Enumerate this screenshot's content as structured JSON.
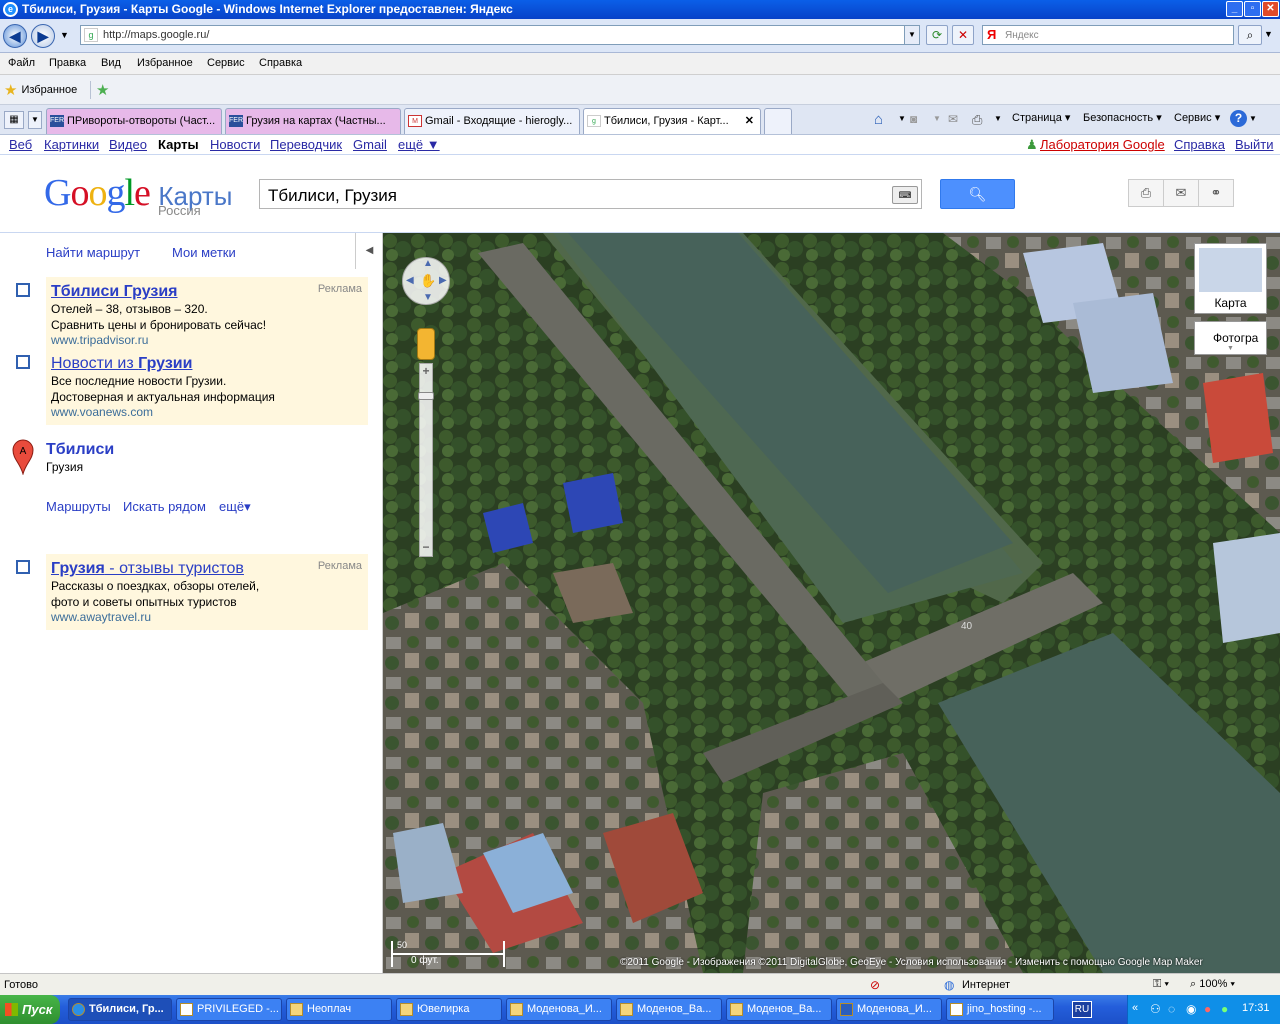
{
  "window": {
    "title": "Тбилиси, Грузия - Карты Google - Windows Internet Explorer предоставлен: Яндекс"
  },
  "addressbar": {
    "url": "http://maps.google.ru/",
    "search_placeholder": "Яндекс"
  },
  "menu": [
    "Файл",
    "Правка",
    "Вид",
    "Избранное",
    "Сервис",
    "Справка"
  ],
  "favorites": {
    "label": "Избранное"
  },
  "tabs": [
    {
      "label": "ПРивороты-отвороты (Част...",
      "active": false,
      "color": "#e7b9e9"
    },
    {
      "label": "Грузия на картах (Частны...",
      "active": false,
      "color": "#e7b9e9"
    },
    {
      "label": "Gmail - Входящие - hierogly...",
      "active": false,
      "color": "#eef2fb"
    },
    {
      "label": "Тбилиси, Грузия - Карт...",
      "active": true,
      "color": "#ffffff"
    }
  ],
  "ie_toolbar": {
    "page": "Страница",
    "security": "Безопасность",
    "tools": "Сервис"
  },
  "gbar": {
    "links": [
      "Веб",
      "Картинки",
      "Видео",
      "Карты",
      "Новости",
      "Переводчик",
      "Gmail",
      "ещё ▼"
    ],
    "active": "Карты",
    "right": {
      "lab": "Лаборатория Google",
      "help": "Справка",
      "logout": "Выйти"
    }
  },
  "header": {
    "logo_brand": "Google",
    "logo_product": "Карты",
    "logo_region": "Россия",
    "query": "Тбилиси, Грузия"
  },
  "left_panel": {
    "links": {
      "directions": "Найти маршрут",
      "my_places": "Мои метки"
    },
    "ads_top": [
      {
        "title_a": "Тбилиси Грузия",
        "title_b": "",
        "line1": "Отелей – 38, отзывов – 320.",
        "line2": "Сравнить цены и бронировать сейчас!",
        "url": "www.tripadvisor.ru",
        "label": "Реклама"
      },
      {
        "title_a": "Новости из ",
        "title_b": "Грузии",
        "line1": "Все последние новости Грузии.",
        "line2": "Достоверная и актуальная информация",
        "url": "www.voanews.com",
        "label": ""
      }
    ],
    "result": {
      "marker": "A",
      "name": "Тбилиси",
      "country": "Грузия",
      "actions": [
        "Маршруты",
        "Искать рядом",
        "ещё▾"
      ]
    },
    "ad_bottom": {
      "title_a": "Грузия",
      "title_b": " - отзывы туристов",
      "line1": "Рассказы о поездках, обзоры отелей,",
      "line2": "фото и советы опытных туристов",
      "url": "www.awaytravel.ru",
      "label": "Реклама"
    }
  },
  "map": {
    "type_buttons": {
      "map": "Карта",
      "photos": "Фотогра"
    },
    "scale": {
      "top": "50",
      "bottom": "0 фут."
    },
    "copyright": "©2011 Google - Изображения ©2011 DigitalGlobe, GeoEye - Условия использования - Изменить с помощью Google Map Maker",
    "label_road": "40"
  },
  "statusbar": {
    "left": "Готово",
    "zone": "Интернет",
    "zoom": "100%"
  },
  "taskbar": {
    "start": "Пуск",
    "items": [
      "Тбилиси, Гр...",
      "PRIVILEGED -...",
      "Неоплач",
      "Ювелирка",
      "Моденова_И...",
      "Моденов_Ва...",
      "Моденов_Ва...",
      "Моденова_И...",
      "jino_hosting -..."
    ],
    "lang": "RU",
    "clock": "17:31"
  }
}
